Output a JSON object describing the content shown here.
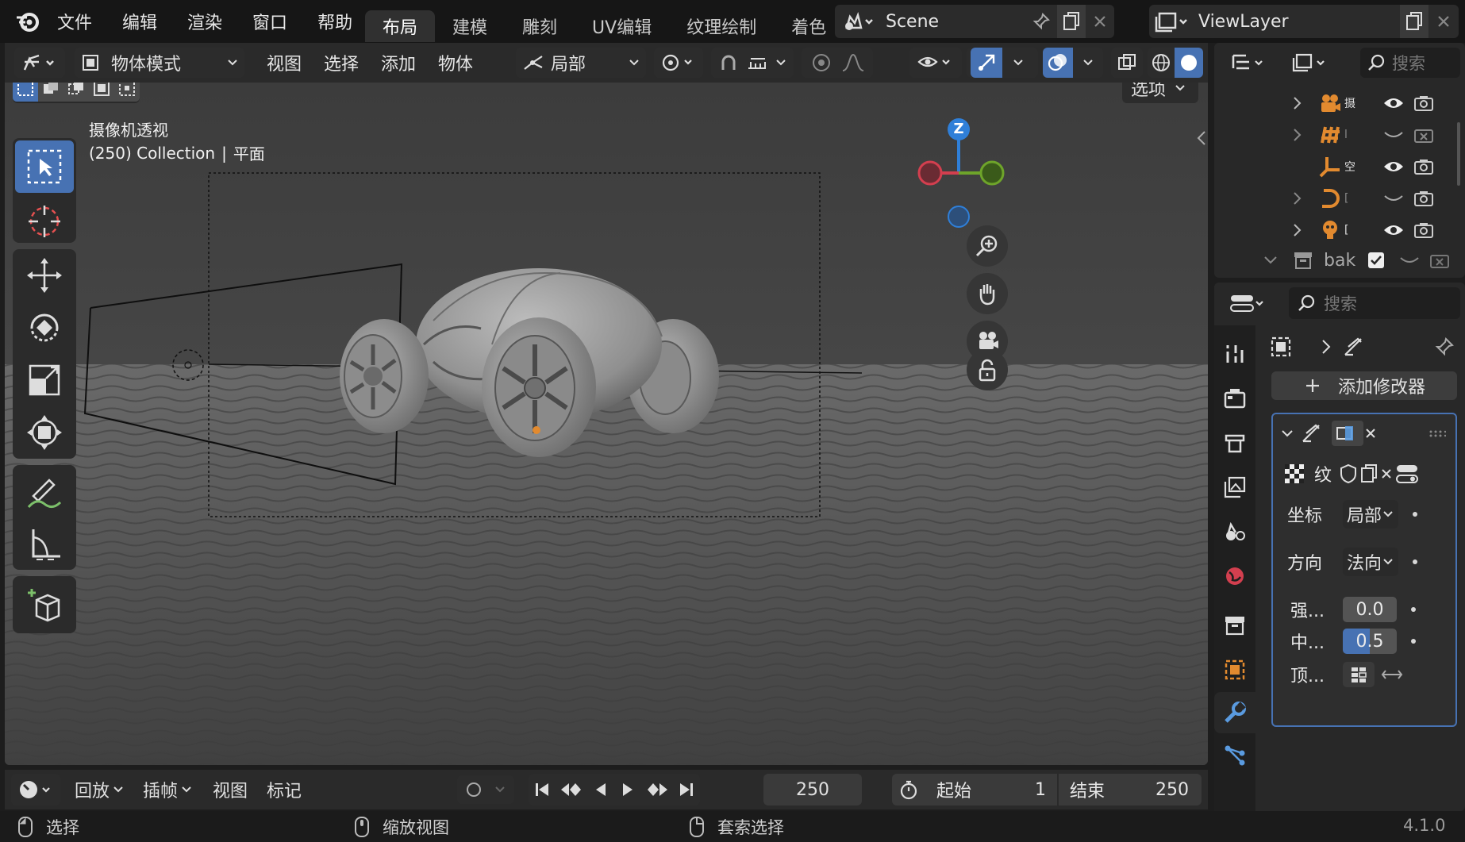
{
  "topbar": {
    "menus": [
      "文件",
      "编辑",
      "渲染",
      "窗口",
      "帮助"
    ],
    "workspaces": [
      {
        "label": "布局",
        "active": true
      },
      {
        "label": "建模",
        "active": false
      },
      {
        "label": "雕刻",
        "active": false
      },
      {
        "label": "UV编辑",
        "active": false
      },
      {
        "label": "纹理绘制",
        "active": false
      },
      {
        "label": "着色",
        "active": false
      }
    ],
    "scene_name": "Scene",
    "view_layer_name": "ViewLayer"
  },
  "viewport_header": {
    "mode": "物体模式",
    "menus": [
      "视图",
      "选择",
      "添加",
      "物体"
    ],
    "transform_orientation": "局部",
    "options_label": "选项"
  },
  "viewport": {
    "view_name": "摄像机透视",
    "info_collection": "(250) Collection",
    "info_object": "平面",
    "gizmo_z_label": "Z"
  },
  "timeline": {
    "menus": [
      "回放",
      "插帧",
      "视图",
      "标记"
    ],
    "current_frame": "250",
    "start_label": "起始",
    "start_value": "1",
    "end_label": "结束",
    "end_value": "250"
  },
  "statusbar": {
    "items": [
      "选择",
      "缩放视图",
      "套索选择"
    ],
    "version": "4.1.0"
  },
  "outliner": {
    "search_placeholder": "搜索",
    "rows": [
      {
        "icon": "camera-object-icon",
        "label": "摄",
        "visible": true
      },
      {
        "icon": "light-grid-icon",
        "label": "l",
        "visible": false
      },
      {
        "icon": "empty-axes-icon",
        "label": "空",
        "visible": true
      },
      {
        "icon": "curve-icon",
        "label": "[",
        "visible": false
      },
      {
        "icon": "light-bulb-icon",
        "label": "[",
        "visible": true
      }
    ],
    "collection_label": "bak"
  },
  "properties": {
    "search_placeholder": "搜索",
    "add_modifier_label": "添加修改器",
    "texture_label": "纹",
    "coords_label": "坐标",
    "coords_value": "局部",
    "direction_label": "方向",
    "direction_value": "法向",
    "strength_label": "强...",
    "strength_value": "0.0",
    "midlevel_label": "中...",
    "midlevel_value": "0.5",
    "vertex_group_label": "顶..."
  },
  "colors": {
    "accent": "#4772b3",
    "axis_x": "#d33f4f",
    "axis_y": "#6ea42a",
    "axis_z": "#2f7fd8",
    "object_orange": "#e28a2f"
  }
}
